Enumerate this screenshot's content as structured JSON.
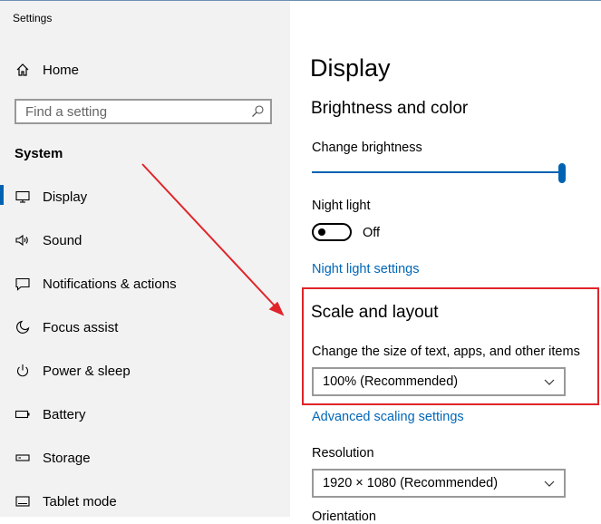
{
  "app": {
    "title": "Settings"
  },
  "sidebar": {
    "home_label": "Home",
    "search_placeholder": "Find a setting",
    "section_label": "System",
    "items": [
      {
        "label": "Display",
        "icon": "monitor-icon"
      },
      {
        "label": "Sound",
        "icon": "speaker-icon"
      },
      {
        "label": "Notifications & actions",
        "icon": "notification-icon"
      },
      {
        "label": "Focus assist",
        "icon": "moon-icon"
      },
      {
        "label": "Power & sleep",
        "icon": "power-icon"
      },
      {
        "label": "Battery",
        "icon": "battery-icon"
      },
      {
        "label": "Storage",
        "icon": "storage-icon"
      },
      {
        "label": "Tablet mode",
        "icon": "tablet-icon"
      }
    ],
    "selected": "Display"
  },
  "main": {
    "title": "Display",
    "brightness": {
      "heading": "Brightness and color",
      "change_brightness_label": "Change brightness",
      "brightness_value": 1.0,
      "night_light_label": "Night light",
      "night_light_state": "Off",
      "night_light_settings_link": "Night light settings"
    },
    "scale": {
      "heading": "Scale and layout",
      "size_label": "Change the size of text, apps, and other items",
      "size_value": "100% (Recommended)",
      "advanced_link": "Advanced scaling settings",
      "resolution_label": "Resolution",
      "resolution_value": "1920 × 1080 (Recommended)",
      "orientation_label": "Orientation"
    }
  },
  "colors": {
    "accent": "#0063b1",
    "link": "#0067b8",
    "annotation": "#e0242a",
    "sidebar_bg": "#f2f2f2"
  }
}
